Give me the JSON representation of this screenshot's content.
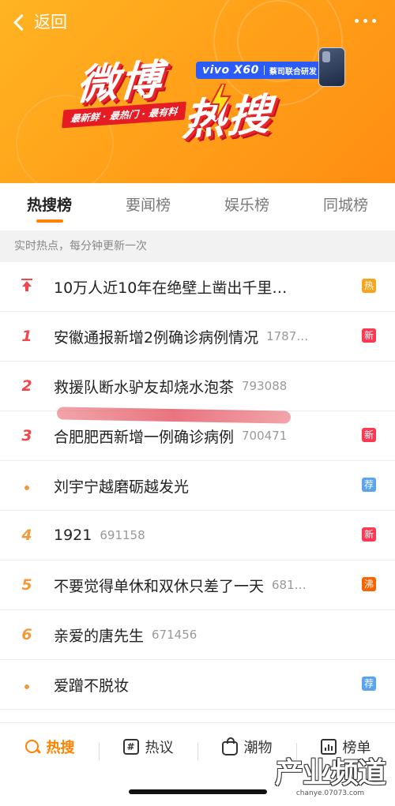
{
  "header": {
    "back_label": "返回",
    "logo_part1": "微博",
    "logo_part2": "热搜",
    "slogan": "最新鲜 · 最热门 · 最有料",
    "sponsor_brand": "vivo X60",
    "sponsor_desc": "蔡司联合研发"
  },
  "tabs": [
    {
      "label": "热搜榜",
      "active": true
    },
    {
      "label": "要闻榜",
      "active": false
    },
    {
      "label": "娱乐榜",
      "active": false
    },
    {
      "label": "同城榜",
      "active": false
    }
  ],
  "subheader": "实时热点，每分钟更新一次",
  "items": [
    {
      "rank": "",
      "title": "10万人近10年在绝壁上凿出千里…",
      "count": "",
      "badge": "热",
      "badge_color": "#f7a51c"
    },
    {
      "rank": "1",
      "title": "安徽通报新增2例确诊病例情况",
      "count": "1787…",
      "badge": "新",
      "badge_color": "#ff3852"
    },
    {
      "rank": "2",
      "title": "救援队断水驴友却烧水泡茶",
      "count": "793088",
      "badge": "",
      "badge_color": ""
    },
    {
      "rank": "3",
      "title": "合肥肥西新增一例确诊病例",
      "count": "700471",
      "badge": "新",
      "badge_color": "#ff3852"
    },
    {
      "rank": "",
      "title": "刘宇宁越磨砺越发光",
      "count": "",
      "badge": "荐",
      "badge_color": "#5aa4ee"
    },
    {
      "rank": "4",
      "title": "1921",
      "count": "691158",
      "badge": "新",
      "badge_color": "#ff3852"
    },
    {
      "rank": "5",
      "title": "不要觉得单休和双休只差了一天",
      "count": "681…",
      "badge": "沸",
      "badge_color": "#f86400"
    },
    {
      "rank": "6",
      "title": "亲爱的唐先生",
      "count": "671456",
      "badge": "",
      "badge_color": ""
    },
    {
      "rank": "",
      "title": "爱蹭不脱妆",
      "count": "",
      "badge": "荐",
      "badge_color": "#5aa4ee"
    }
  ],
  "bottom_nav": [
    {
      "label": "热搜",
      "icon": "search-icon",
      "active": true
    },
    {
      "label": "热议",
      "icon": "hash-icon",
      "active": false
    },
    {
      "label": "潮物",
      "icon": "bag-icon",
      "active": false
    },
    {
      "label": "榜单",
      "icon": "chart-icon",
      "active": false
    }
  ],
  "watermark": {
    "big": "产业频道",
    "small": "chanye.07073.com"
  },
  "colors": {
    "accent": "#ff8200",
    "rank_top": "#f2464c",
    "rank_other": "#f19b3c",
    "banner": "#ffa21a"
  }
}
